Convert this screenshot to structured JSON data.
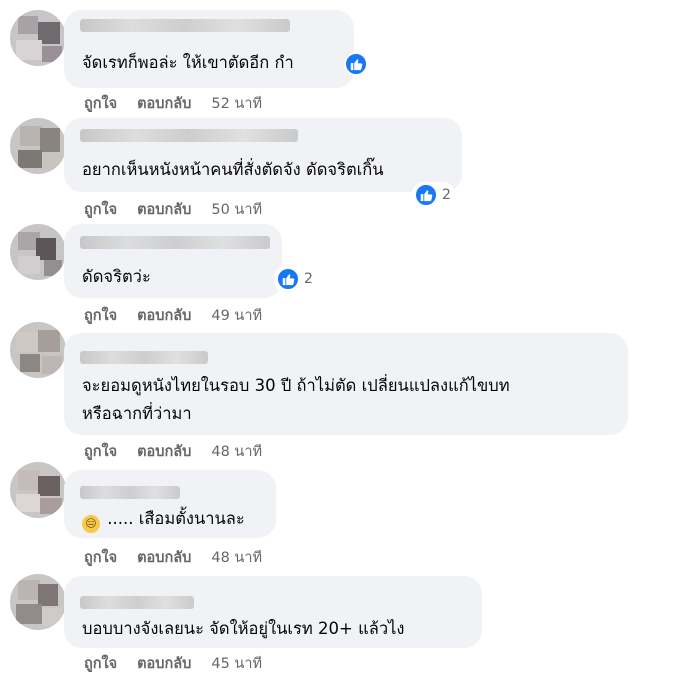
{
  "comments": [
    {
      "text_lines": [
        "จัดเรทก็พอล่ะ ให้เขาตัดอีก กำ"
      ],
      "reaction_count": "",
      "like": "ถูกใจ",
      "reply": "ตอบกลับ",
      "time": "52 นาที"
    },
    {
      "text_lines": [
        "อยากเห็นหนังหน้าคนที่สั่งตัดจัง ดัดจริตเกิ๊น"
      ],
      "reaction_count": "2",
      "like": "ถูกใจ",
      "reply": "ตอบกลับ",
      "time": "50 นาที"
    },
    {
      "text_lines": [
        "ดัดจริตว่ะ"
      ],
      "reaction_count": "2",
      "like": "ถูกใจ",
      "reply": "ตอบกลับ",
      "time": "49 นาที"
    },
    {
      "text_lines": [
        "จะยอมดูหนังไทยในรอบ 30 ปี ถ้าไม่ตัด เปลี่ยนแปลงแก้ไขบท",
        "หรือฉากที่ว่ามา"
      ],
      "reaction_count": "",
      "like": "ถูกใจ",
      "reply": "ตอบกลับ",
      "time": "48 นาที"
    },
    {
      "emoji": "😑",
      "text_lines": [
        " ..... เสือมตั้งนานละ"
      ],
      "reaction_count": "",
      "like": "ถูกใจ",
      "reply": "ตอบกลับ",
      "time": "48 นาที"
    },
    {
      "text_lines": [
        "บอบบางจังเลยนะ จัดให้อยู่ในเรท 20+ แล้วไง"
      ],
      "reaction_count": "",
      "like": "ถูกใจ",
      "reply": "ตอบกลับ",
      "time": "45 นาที"
    }
  ],
  "colors": {
    "like_blue": "#1877f2",
    "bubble": "#f0f2f5",
    "meta_gray": "#65676b"
  }
}
